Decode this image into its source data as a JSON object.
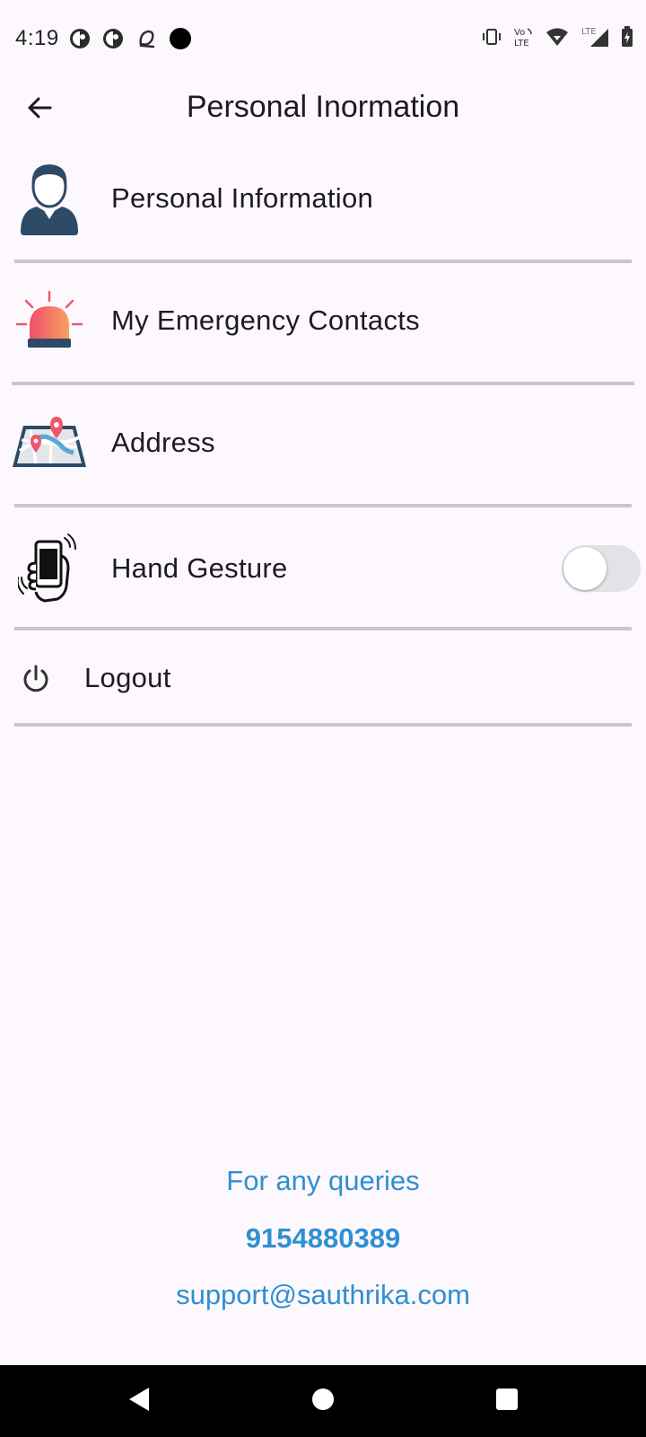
{
  "status_bar": {
    "time": "4:19",
    "left_icons": [
      "app-notification-icon",
      "app-notification-icon",
      "q-app-icon",
      "dot-icon"
    ],
    "right_icons": [
      "vibrate-icon",
      "volte-icon",
      "wifi-icon",
      "lte-signal-icon",
      "battery-charging-icon"
    ],
    "volte_label": "Vo LTE",
    "lte_label": "LTE"
  },
  "app_bar": {
    "back_icon": "arrow-left-icon",
    "title": "Personal Inormation"
  },
  "menu": {
    "items": [
      {
        "label": "Personal Information",
        "icon": "person-avatar-icon"
      },
      {
        "label": "My Emergency Contacts",
        "icon": "emergency-siren-icon"
      },
      {
        "label": "Address",
        "icon": "map-pins-icon"
      },
      {
        "label": "Hand Gesture",
        "icon": "hand-phone-icon",
        "toggle_on": false
      },
      {
        "label": "Logout",
        "icon": "power-icon"
      }
    ]
  },
  "footer": {
    "queries_label": "For any queries",
    "phone": "9154880389",
    "email": "support@sauthrika.com"
  },
  "nav_bar": {
    "icons": [
      "back-triangle-icon",
      "home-circle-icon",
      "recents-square-icon"
    ]
  },
  "colors": {
    "background": "#fcf8fd",
    "accent_link": "#2f8fd1",
    "divider": "#cac4cf",
    "icon_dark": "#2d4a66",
    "siren_red": "#f0566b"
  }
}
